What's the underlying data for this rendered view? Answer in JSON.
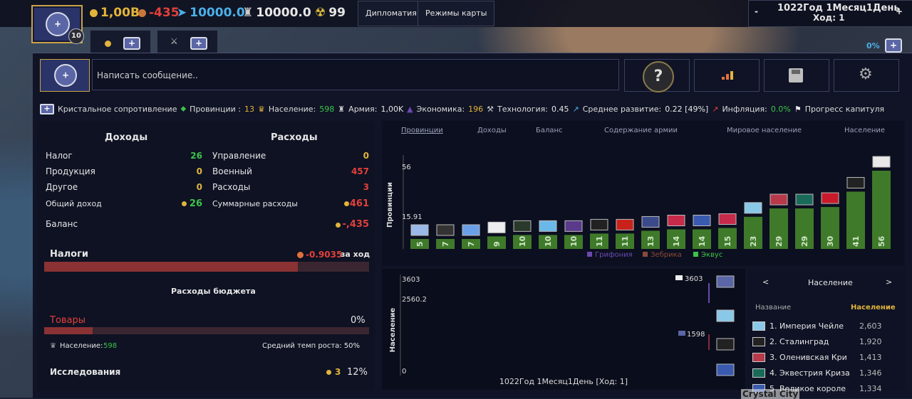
{
  "top": {
    "level": "10",
    "gold": "1,00B",
    "income_delta": "-435",
    "manpower": "10000.0",
    "army": "10000.0",
    "nuke": "99",
    "btn_diplomacy": "Дипломатия",
    "btn_mapmodes": "Режимы карты",
    "date_line": "1022Год 1Месяц1День",
    "turn_line": "Ход: 1",
    "minus": "-",
    "plus": "+",
    "zero_pct": "0%"
  },
  "message": {
    "placeholder": "Написать сообщение.."
  },
  "stats": {
    "country": "Кристальное сопротивление",
    "provinces_label": "Провинции :",
    "provinces": "13",
    "population_label": "Население:",
    "population": "598",
    "army_label": "Армия:",
    "army": "1,00K",
    "economy_label": "Экономика:",
    "economy": "196",
    "tech_label": "Технология:",
    "tech": "0.45",
    "dev_label": "Среднее развитие:",
    "dev": "0.22 [49%]",
    "inflation_label": "Инфляция:",
    "inflation": "0.0%",
    "capitulation_label": "Прогресс капитуля"
  },
  "economy": {
    "income_title": "Доходы",
    "expense_title": "Расходы",
    "income": [
      {
        "label": "Налог",
        "value": "26"
      },
      {
        "label": "Продукция",
        "value": "0"
      },
      {
        "label": "Другое",
        "value": "0"
      },
      {
        "label": "Общий доход",
        "value": "26"
      }
    ],
    "expense": [
      {
        "label": "Управление",
        "value": "0"
      },
      {
        "label": "Военный",
        "value": "457"
      },
      {
        "label": "Расходы",
        "value": "3"
      },
      {
        "label": "Суммарные расходы",
        "value": "461"
      }
    ],
    "balance_label": "Баланс",
    "balance_value": "-,435",
    "taxes_label": "Налоги",
    "taxes_value": "-0.9035",
    "taxes_suffix": "за ход",
    "budget_title": "Расходы бюджета",
    "goods_label": "Товары",
    "goods_value": "0%",
    "pop_label": "Население:",
    "pop_value": "598",
    "growth_label": "Средний темп роста: 50%",
    "research_label": "Исследования",
    "research_count": "3",
    "research_pct": "12%"
  },
  "chart_tabs": [
    "Провинции",
    "Доходы",
    "Баланс",
    "Содержание армии",
    "Мировое население",
    "Население"
  ],
  "chart_data": [
    {
      "type": "bar",
      "ylabel": "Провинции",
      "ticks": [
        "56",
        "15.91"
      ],
      "values": [
        5,
        7,
        7,
        9,
        10,
        10,
        10,
        11,
        11,
        13,
        14,
        14,
        15,
        23,
        29,
        29,
        30,
        41,
        56
      ],
      "legend": [
        "Грифония",
        "Зебрика",
        "Эквус"
      ],
      "legend_colors": [
        "#6a4ab0",
        "#8a4a3a",
        "#3cc44a"
      ]
    },
    {
      "type": "line",
      "ylabel": "Население",
      "ticks": [
        "3603",
        "2560.2",
        "0"
      ],
      "xlabel": "1022Год 1Месяц1День [Ход: 1]",
      "point_labels": [
        "3603",
        "1598"
      ]
    }
  ],
  "side": {
    "title": "Население",
    "prev": "<",
    "next": ">",
    "col_name": "Название",
    "col_pop": "Население",
    "rows": [
      {
        "name": "1. Империя Чейле",
        "value": "2,603"
      },
      {
        "name": "2. Сталинград",
        "value": "1,920"
      },
      {
        "name": "3. Оленивская Кри",
        "value": "1,413"
      },
      {
        "name": "4. Эквестрия Криза",
        "value": "1,346"
      },
      {
        "name": "5. Великое короле",
        "value": "1,334"
      }
    ]
  }
}
